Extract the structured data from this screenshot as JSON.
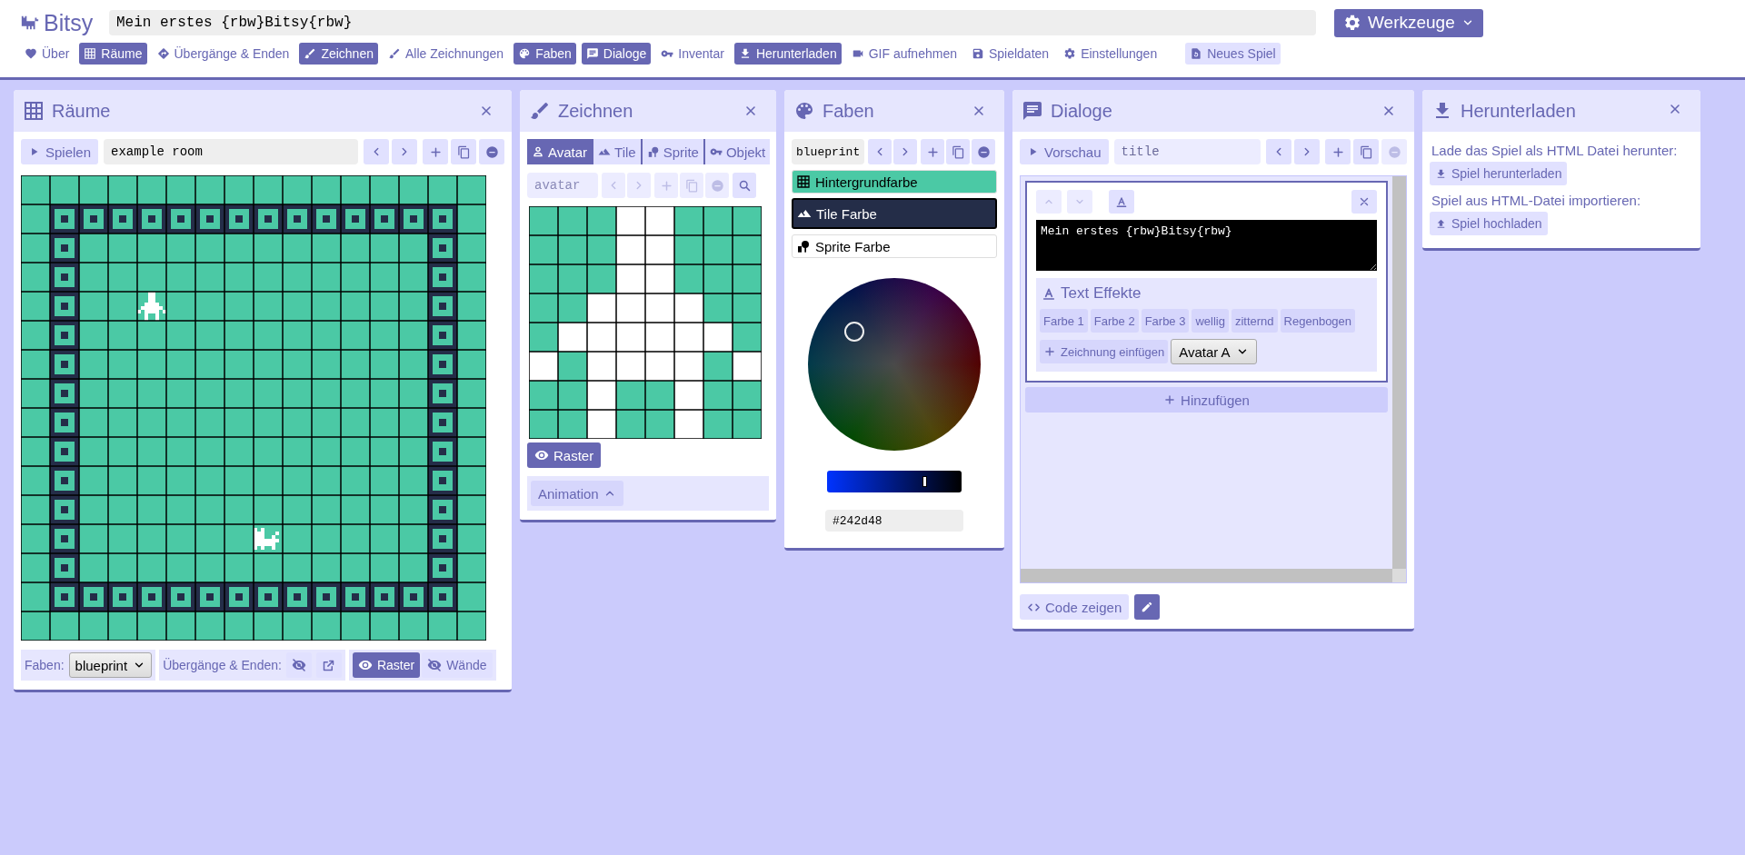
{
  "app": {
    "logo": "Bitsy",
    "title": "Mein erstes {rbw}Bitsy{rbw}",
    "tools_button": "Werkzeuge"
  },
  "nav": [
    {
      "label": "Über",
      "selected": false
    },
    {
      "label": "Räume",
      "selected": true
    },
    {
      "label": "Übergänge & Enden",
      "selected": false
    },
    {
      "label": "Zeichnen",
      "selected": true
    },
    {
      "label": "Alle Zeichnungen",
      "selected": false
    },
    {
      "label": "Faben",
      "selected": true
    },
    {
      "label": "Dialoge",
      "selected": true
    },
    {
      "label": "Inventar",
      "selected": false
    },
    {
      "label": "Herunterladen",
      "selected": true
    },
    {
      "label": "GIF aufnehmen",
      "selected": false
    },
    {
      "label": "Spieldaten",
      "selected": false
    },
    {
      "label": "Einstellungen",
      "selected": false
    }
  ],
  "new_game": "Neues Spiel",
  "rooms": {
    "title": "Räume",
    "play": "Spielen",
    "name": "example room",
    "palette_label": "Faben:",
    "palette_select": "blueprint",
    "exits_label": "Übergänge & Enden:",
    "exits_visible": false,
    "toggles": [
      {
        "label": "Raster",
        "selected": true
      },
      {
        "label": "Wände",
        "selected": false
      }
    ]
  },
  "drawing": {
    "title": "Zeichnen",
    "tabs": [
      {
        "label": "Avatar",
        "selected": true
      },
      {
        "label": "Tile",
        "selected": false
      },
      {
        "label": "Sprite",
        "selected": false
      },
      {
        "label": "Objekt",
        "selected": false
      }
    ],
    "name": "avatar",
    "name_disabled": true,
    "pixels": [
      [
        false,
        false,
        false,
        true,
        true,
        false,
        false,
        false
      ],
      [
        false,
        false,
        false,
        true,
        true,
        false,
        false,
        false
      ],
      [
        false,
        false,
        false,
        true,
        true,
        false,
        false,
        false
      ],
      [
        false,
        false,
        true,
        true,
        true,
        true,
        false,
        false
      ],
      [
        false,
        true,
        true,
        true,
        true,
        true,
        true,
        false
      ],
      [
        true,
        false,
        true,
        true,
        true,
        true,
        false,
        true
      ],
      [
        false,
        false,
        true,
        false,
        false,
        true,
        false,
        false
      ],
      [
        false,
        false,
        true,
        false,
        false,
        true,
        false,
        false
      ]
    ],
    "grid_toggle": {
      "label": "Raster",
      "selected": true
    },
    "animation": "Animation"
  },
  "palettes": {
    "title": "Faben",
    "name": "blueprint",
    "colors": [
      {
        "label": "Hintergrundfarbe",
        "color": "#4bc9a5",
        "selected": false
      },
      {
        "label": "Tile Farbe",
        "color": "#242d48",
        "selected": true
      },
      {
        "label": "Sprite Farbe",
        "color": "#ffffff",
        "selected": false
      }
    ],
    "value_slider": {
      "level": 0.72
    },
    "hex": "#242d48"
  },
  "dialogs": {
    "title": "Dialoge",
    "preview": "Vorschau",
    "name": "title",
    "block": {
      "text": "Mein erstes {rbw}Bitsy{rbw}",
      "effects_title": "Text Effekte",
      "effects": [
        "Farbe 1",
        "Farbe 2",
        "Farbe 3",
        "wellig",
        "zitternd",
        "Regenbogen"
      ],
      "insert": "Zeichnung einfügen",
      "drawing_select": "Avatar A"
    },
    "add": "Hinzufügen",
    "show_code": "Code zeigen"
  },
  "download": {
    "title": "Herunterladen",
    "download_text": "Lade das Spiel als HTML Datei herunter:",
    "download_button": "Spiel herunterladen",
    "import_text": "Spiel aus HTML-Datei importieren:",
    "upload_button": "Spiel hochladen"
  }
}
